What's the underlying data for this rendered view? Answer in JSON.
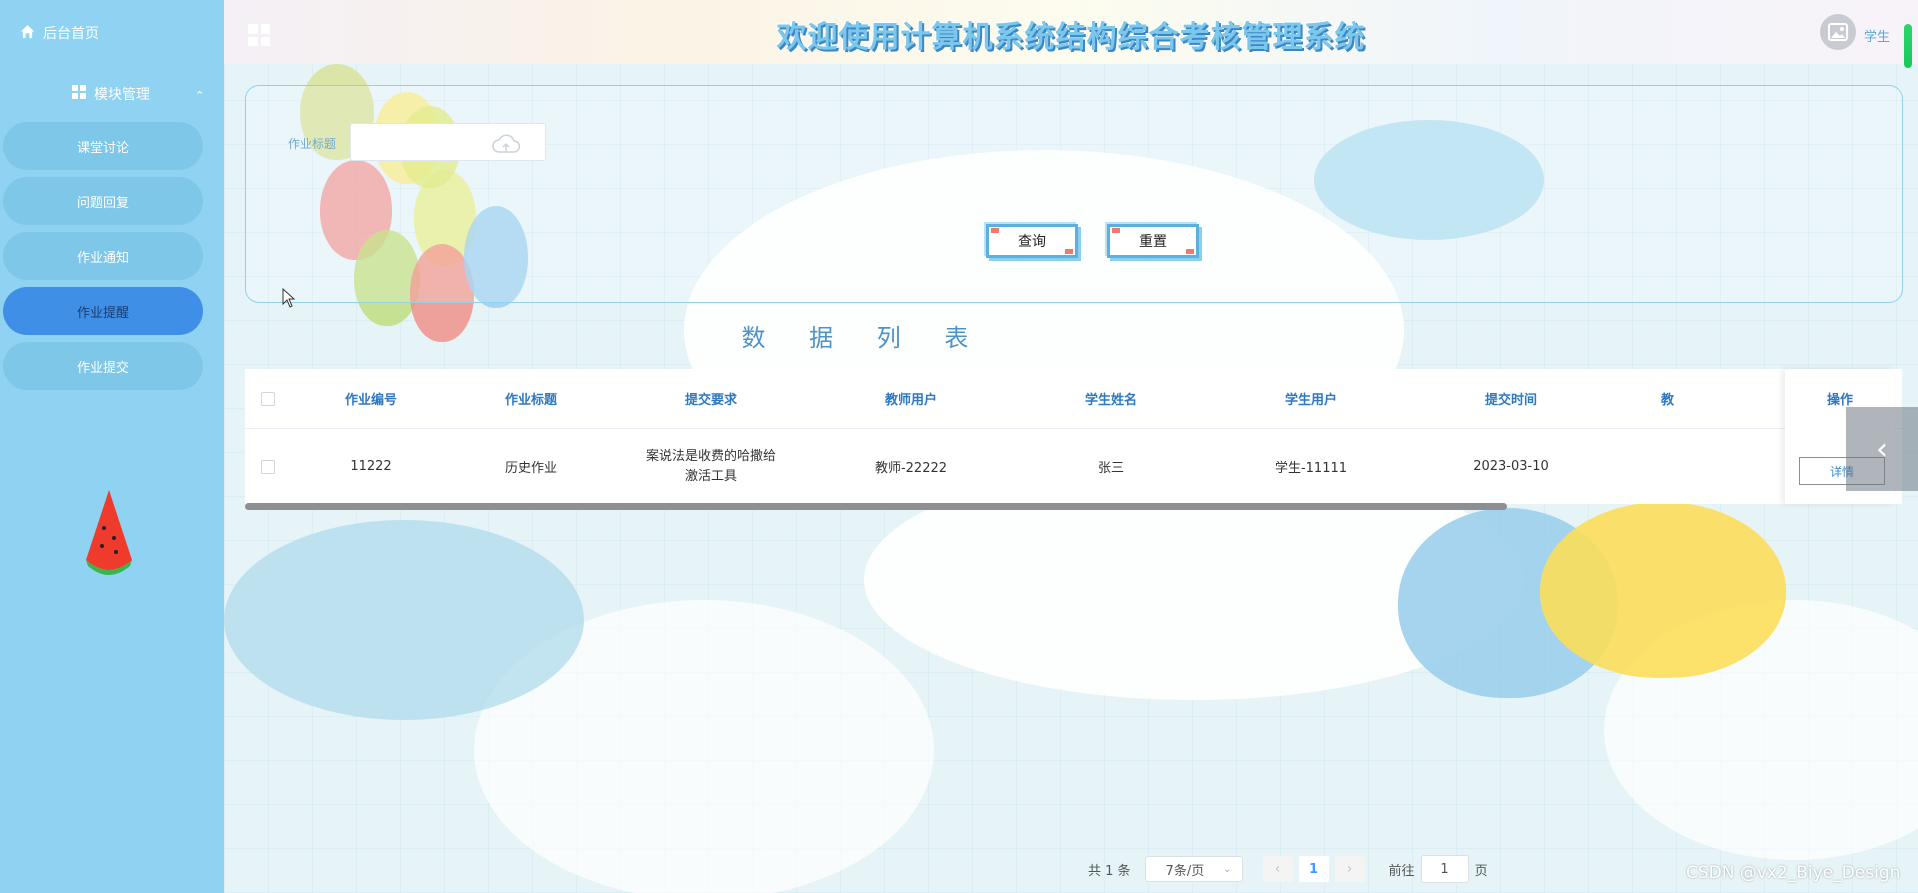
{
  "header": {
    "title": "欢迎使用计算机系统结构综合考核管理系统",
    "user_role": "学生"
  },
  "sidebar": {
    "home_label": "后台首页",
    "group_label": "模块管理",
    "items": [
      {
        "label": "课堂讨论",
        "active": false
      },
      {
        "label": "问题回复",
        "active": false
      },
      {
        "label": "作业通知",
        "active": false
      },
      {
        "label": "作业提醒",
        "active": true
      },
      {
        "label": "作业提交",
        "active": false
      }
    ]
  },
  "search": {
    "field_label": "作业标题",
    "field_value": "",
    "query_button": "查询",
    "reset_button": "重置"
  },
  "list_title": "数 据 列 表",
  "table": {
    "columns": [
      "作业编号",
      "作业标题",
      "提交要求",
      "教师用户",
      "学生姓名",
      "学生用户",
      "提交时间",
      "教"
    ],
    "rows": [
      [
        "11222",
        "历史作业",
        "案说法是收费的哈撒给激活工具",
        "教师-22222",
        "张三",
        "学生-11111",
        "2023-03-10",
        ""
      ]
    ],
    "operation_header": "操作",
    "detail_button": "详情"
  },
  "pagination": {
    "total_text": "共 1 条",
    "page_size": "7条/页",
    "current_page": "1",
    "goto_prefix": "前往",
    "goto_value": "1",
    "goto_suffix": "页"
  },
  "watermark": "CSDN @vx2_Biye_Design",
  "colors": {
    "sidebar_bg": "#8fd2f2",
    "sidebar_active": "#3f8fe6",
    "title_color": "#7cc8ec",
    "header_text": "#2e78c0"
  }
}
